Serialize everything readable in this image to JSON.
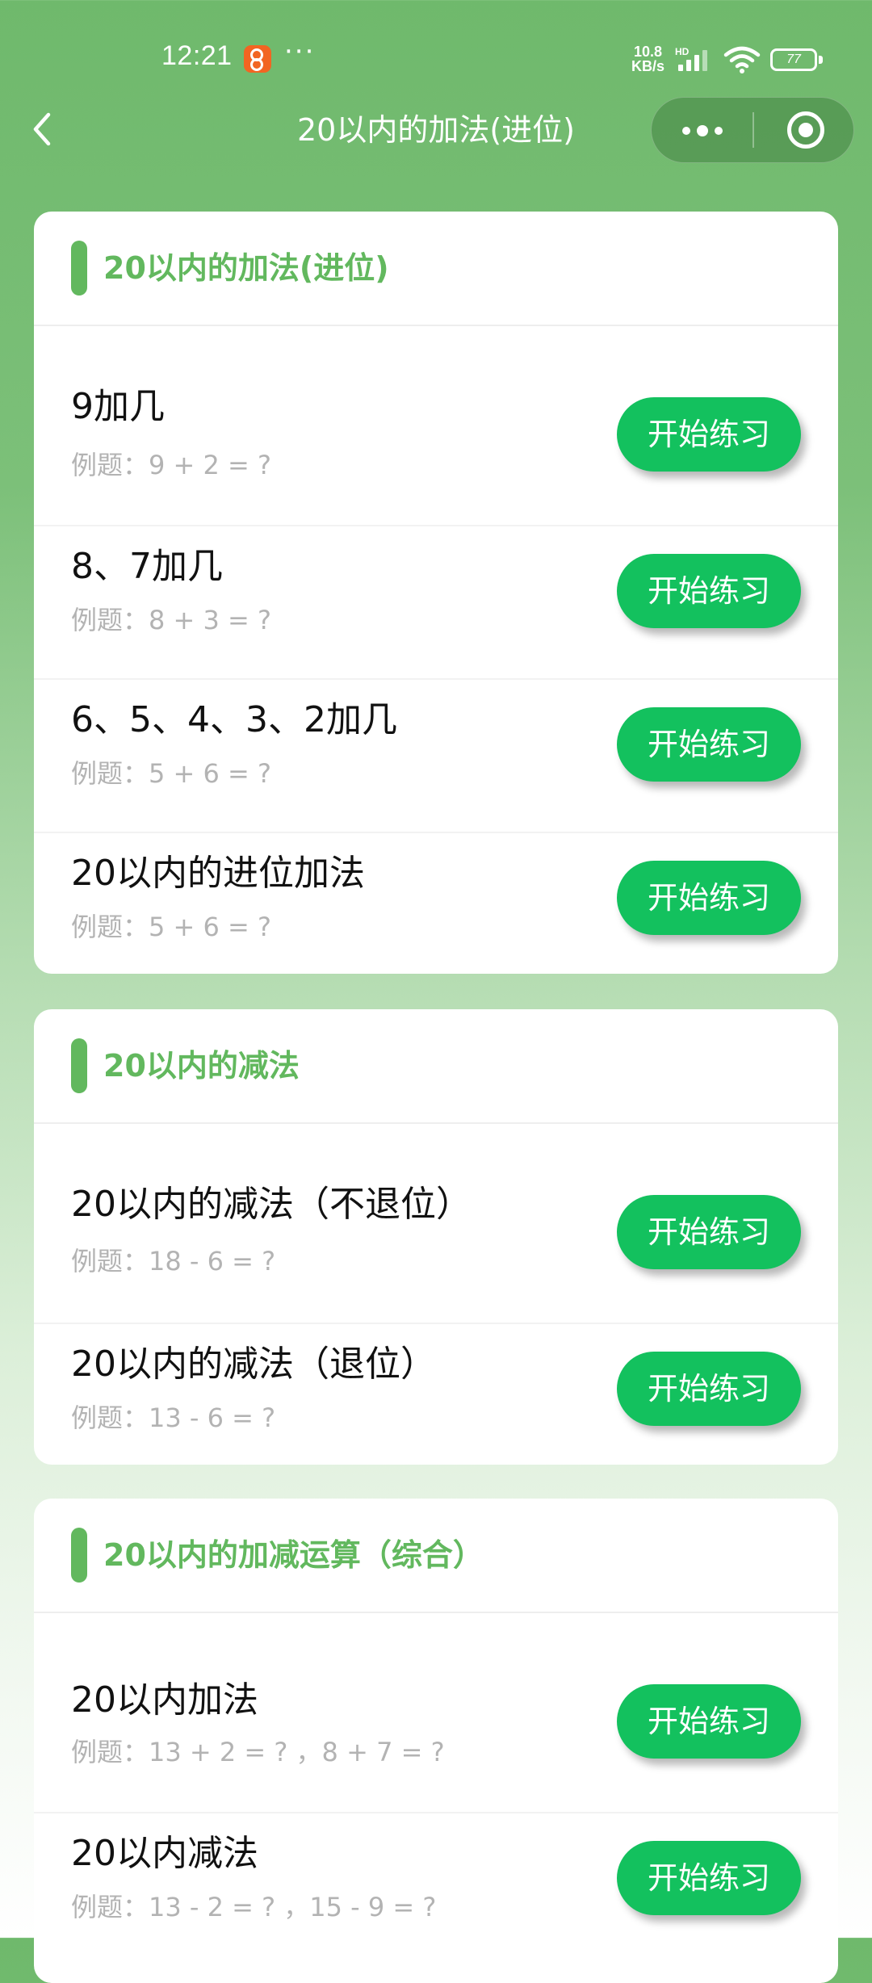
{
  "status_bar": {
    "time": "12:21",
    "more": "···",
    "net_speed_value": "10.8",
    "net_speed_unit": "KB/s",
    "hd": "HD",
    "battery": "77",
    "icons": [
      "app-notification-icon",
      "signal-icon",
      "wifi-icon",
      "battery-icon"
    ]
  },
  "nav": {
    "title": "20以内的加法(进位)",
    "icons": [
      "back-icon",
      "more-icon",
      "close-miniprogram-icon"
    ]
  },
  "colors": {
    "header_green": "#6fb96c",
    "accent_green": "#62b85e",
    "button_green": "#13c15e",
    "example_gray": "#b3b3b3"
  },
  "sections": [
    {
      "title": "20以内的加法(进位)",
      "items": [
        {
          "name": "9加几",
          "example": "例题：9 + 2 = ?",
          "button": "开始练习"
        },
        {
          "name": "8、7加几",
          "example": "例题：8 + 3 = ?",
          "button": "开始练习"
        },
        {
          "name": "6、5、4、3、2加几",
          "example": "例题：5 + 6 = ?",
          "button": "开始练习"
        },
        {
          "name": "20以内的进位加法",
          "example": "例题：5 + 6 = ?",
          "button": "开始练习"
        }
      ]
    },
    {
      "title": "20以内的减法",
      "items": [
        {
          "name": "20以内的减法（不退位）",
          "example": "例题：18 - 6 = ?",
          "button": "开始练习"
        },
        {
          "name": "20以内的减法（退位）",
          "example": "例题：13 - 6 = ?",
          "button": "开始练习"
        }
      ]
    },
    {
      "title": "20以内的加减运算（综合）",
      "items": [
        {
          "name": "20以内加法",
          "example": "例题：13 + 2 = ? ，8 + 7 = ?",
          "button": "开始练习"
        },
        {
          "name": "20以内减法",
          "example": "例题：13 - 2 = ? ，15 - 9 = ?",
          "button": "开始练习"
        }
      ]
    }
  ]
}
